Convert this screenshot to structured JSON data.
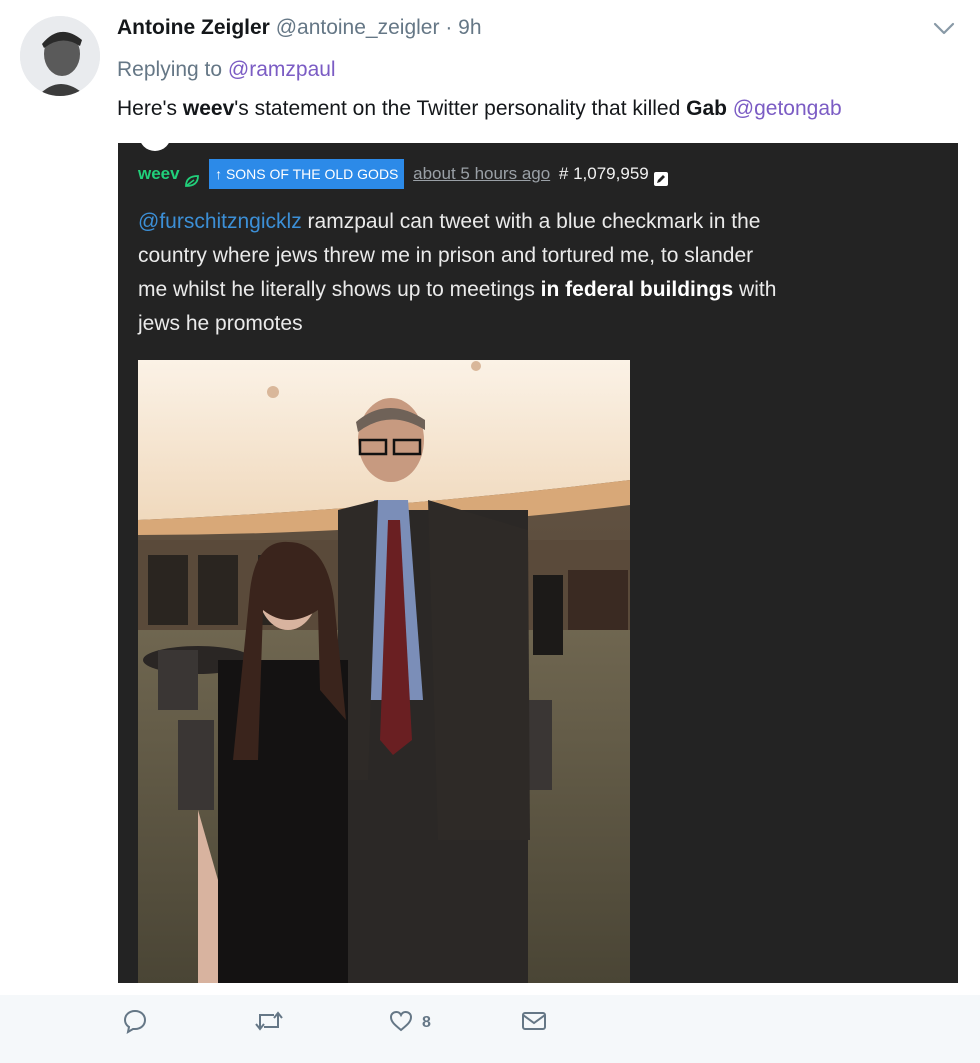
{
  "tweet": {
    "author_name": "Antoine Zeigler",
    "author_handle": "@antoine_zeigler",
    "separator": "·",
    "time": "9h",
    "replying_prefix": "Replying to",
    "replying_handle": "@ramzpaul",
    "text_part1": "Here's ",
    "text_bold1": "weev",
    "text_part2": "'s statement on the Twitter personality that killed ",
    "text_bold2": "Gab",
    "text_link": "@getongab",
    "like_count": "8"
  },
  "gab_post": {
    "username": "weev",
    "badge": "SONS OF THE OLD GODS",
    "time": "about 5 hours ago",
    "post_id": "# 1,079,959",
    "mention": "@furschitzngicklz",
    "body_part1": " ramzpaul can tweet with a blue checkmark in the country where jews threw me in prison and tortured me, to slander me whilst he literally shows up to meetings ",
    "body_bold": "in federal buildings",
    "body_part2": " with jews he promotes"
  },
  "colors": {
    "link": "#7b5cc4",
    "gab_green": "#21cf7a",
    "badge_blue": "#2c8ae8",
    "card_bg": "#232323"
  },
  "icons": [
    "chevron-down-icon",
    "reply-icon",
    "retweet-icon",
    "heart-icon",
    "direct-message-icon",
    "verified-leaf-icon",
    "edit-icon",
    "arrow-up-icon"
  ]
}
